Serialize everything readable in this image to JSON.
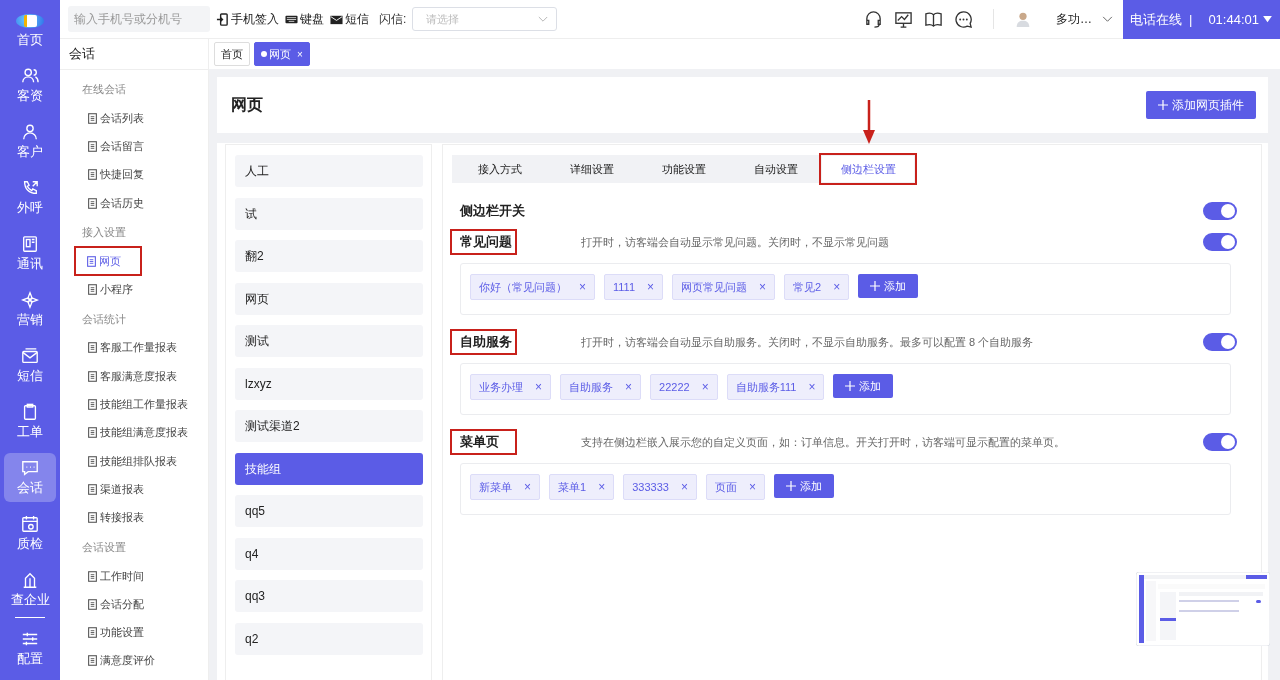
{
  "rail": {
    "items": [
      {
        "label": "首页",
        "selected": false
      },
      {
        "label": "客资",
        "selected": false
      },
      {
        "label": "客户",
        "selected": false
      },
      {
        "label": "外呼",
        "selected": false
      },
      {
        "label": "通讯",
        "selected": false
      },
      {
        "label": "营销",
        "selected": false
      },
      {
        "label": "短信",
        "selected": false
      },
      {
        "label": "工单",
        "selected": false
      },
      {
        "label": "会话",
        "selected": true
      },
      {
        "label": "质检",
        "selected": false
      },
      {
        "label": "查企业",
        "selected": false
      },
      {
        "label": "配置",
        "selected": false
      }
    ]
  },
  "topbar": {
    "search": {
      "placeholder": "输入手机号或分机号"
    },
    "actions": [
      "手机签入",
      "键盘",
      "短信"
    ],
    "flash_label": "闪信:",
    "flash_select": {
      "placeholder": "请选择"
    },
    "user": "多功…",
    "status": "电话在线",
    "separator": "|",
    "timer": "01:44:01"
  },
  "sidebar": {
    "title": "会话",
    "groups": [
      {
        "heading": "在线会话",
        "items": [
          {
            "label": "会话列表",
            "selected": false,
            "highlighted": false
          },
          {
            "label": "会话留言",
            "selected": false,
            "highlighted": false
          },
          {
            "label": "快捷回复",
            "selected": false,
            "highlighted": false
          },
          {
            "label": "会话历史",
            "selected": false,
            "highlighted": false
          }
        ]
      },
      {
        "heading": "接入设置",
        "items": [
          {
            "label": "网页",
            "selected": true,
            "highlighted": true
          },
          {
            "label": "小程序",
            "selected": false,
            "highlighted": false
          }
        ]
      },
      {
        "heading": "会话统计",
        "items": [
          {
            "label": "客服工作量报表",
            "selected": false,
            "highlighted": false
          },
          {
            "label": "客服满意度报表",
            "selected": false,
            "highlighted": false
          },
          {
            "label": "技能组工作量报表",
            "selected": false,
            "highlighted": false
          },
          {
            "label": "技能组满意度报表",
            "selected": false,
            "highlighted": false
          },
          {
            "label": "技能组排队报表",
            "selected": false,
            "highlighted": false
          },
          {
            "label": "渠道报表",
            "selected": false,
            "highlighted": false
          },
          {
            "label": "转接报表",
            "selected": false,
            "highlighted": false
          }
        ]
      },
      {
        "heading": "会话设置",
        "items": [
          {
            "label": "工作时间",
            "selected": false,
            "highlighted": false
          },
          {
            "label": "会话分配",
            "selected": false,
            "highlighted": false
          },
          {
            "label": "功能设置",
            "selected": false,
            "highlighted": false
          },
          {
            "label": "满意度评价",
            "selected": false,
            "highlighted": false
          }
        ]
      }
    ]
  },
  "page_tabs": [
    {
      "label": "首页",
      "selected": false,
      "closable": false
    },
    {
      "label": "网页",
      "selected": true,
      "closable": true
    }
  ],
  "close_mark": "×",
  "header": {
    "title": "网页",
    "add_button": "添加网页插件"
  },
  "channels": [
    {
      "label": "人工",
      "selected": false
    },
    {
      "label": "试",
      "selected": false
    },
    {
      "label": "翻2",
      "selected": false
    },
    {
      "label": "网页",
      "selected": false
    },
    {
      "label": "测试",
      "selected": false
    },
    {
      "label": "lzxyz",
      "selected": false
    },
    {
      "label": "测试渠道2",
      "selected": false
    },
    {
      "label": "技能组",
      "selected": true
    },
    {
      "label": "qq5",
      "selected": false
    },
    {
      "label": "q4",
      "selected": false
    },
    {
      "label": "qq3",
      "selected": false
    },
    {
      "label": "q2",
      "selected": false
    }
  ],
  "settings_tabs": [
    {
      "label": "接入方式",
      "selected": false,
      "highlighted": false
    },
    {
      "label": "详细设置",
      "selected": false,
      "highlighted": false
    },
    {
      "label": "功能设置",
      "selected": false,
      "highlighted": false
    },
    {
      "label": "自动设置",
      "selected": false,
      "highlighted": false
    },
    {
      "label": "侧边栏设置",
      "selected": true,
      "highlighted": true
    }
  ],
  "sidebar_switch": {
    "label": "侧边栏开关",
    "on": true
  },
  "sections": [
    {
      "title": "常见问题",
      "highlighted": true,
      "description": "打开时，访客端会自动显示常见问题。关闭时，不显示常见问题",
      "on": true,
      "tags": [
        "你好（常见问题）",
        "1111",
        "网页常见问题",
        "常见2"
      ],
      "add_label": "添加"
    },
    {
      "title": "自助服务",
      "highlighted": true,
      "description": "打开时，访客端会自动显示自助服务。关闭时，不显示自助服务。最多可以配置 8 个自助服务",
      "on": true,
      "tags": [
        "业务办理",
        "自助服务",
        "22222",
        "自助服务111"
      ],
      "add_label": "添加"
    },
    {
      "title": "菜单页",
      "highlighted": true,
      "description": "支持在侧边栏嵌入展示您的自定义页面，如：订单信息。开关打开时，访客端可显示配置的菜单页。",
      "on": true,
      "tags": [
        "新菜单",
        "菜单1",
        "333333",
        "页面"
      ],
      "add_label": "添加"
    }
  ]
}
